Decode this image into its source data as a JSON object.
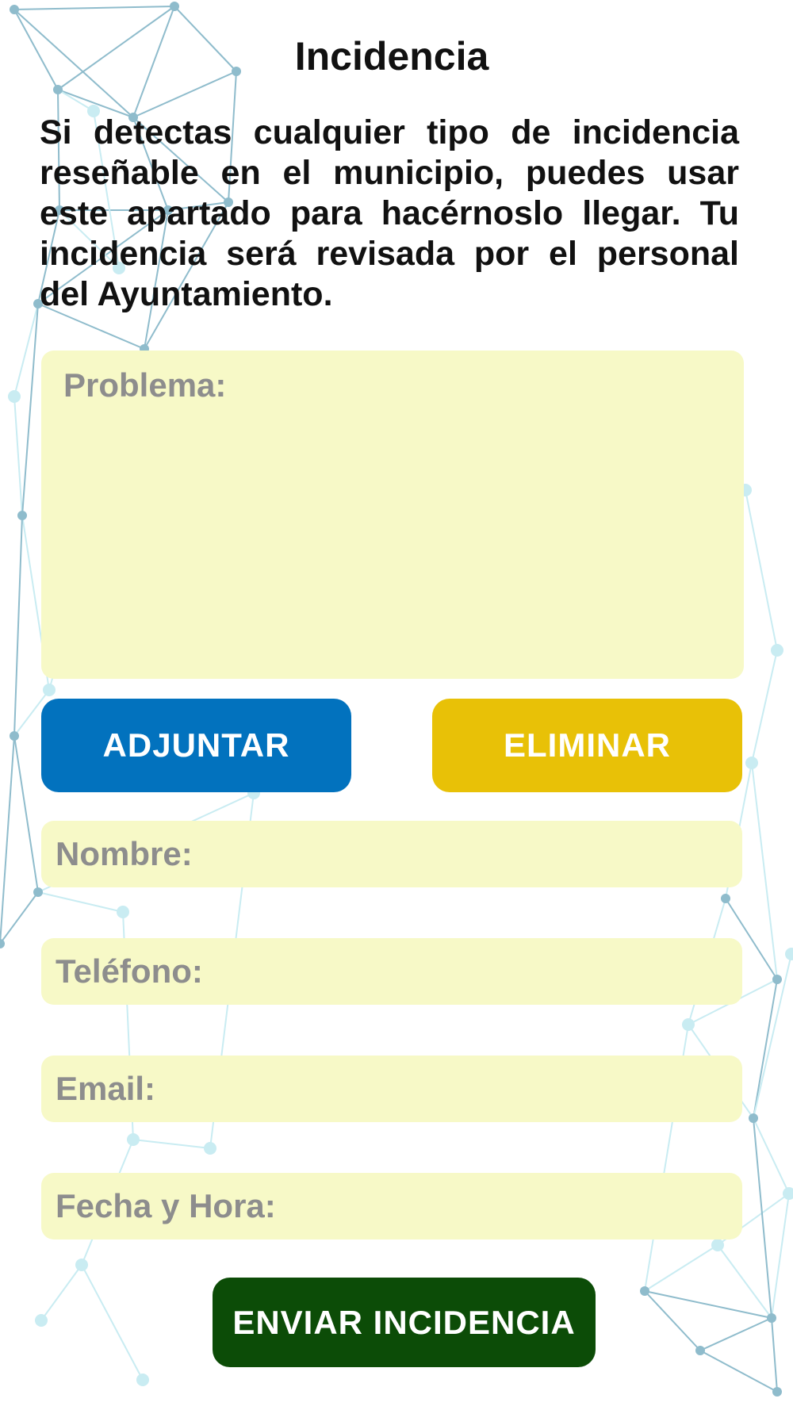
{
  "page": {
    "title": "Incidencia",
    "intro": "Si detectas cualquier tipo de incidencia reseñable en el municipio, puedes usar este apartado para hacérnoslo llegar. Tu incidencia será revisada por el personal del Ayuntamiento."
  },
  "form": {
    "problem_placeholder": "Problema:",
    "attach_label": "ADJUNTAR",
    "delete_label": "ELIMINAR",
    "name_placeholder": "Nombre:",
    "phone_placeholder": "Teléfono:",
    "email_placeholder": "Email:",
    "datetime_placeholder": "Fecha y Hora:",
    "submit_label": "ENVIAR INCIDENCIA"
  },
  "colors": {
    "field_bg": "#f7f9c7",
    "attach_button": "#0272be",
    "delete_button": "#e8c107",
    "submit_button": "#0c4c07",
    "network_lines": "#8fbccc"
  }
}
